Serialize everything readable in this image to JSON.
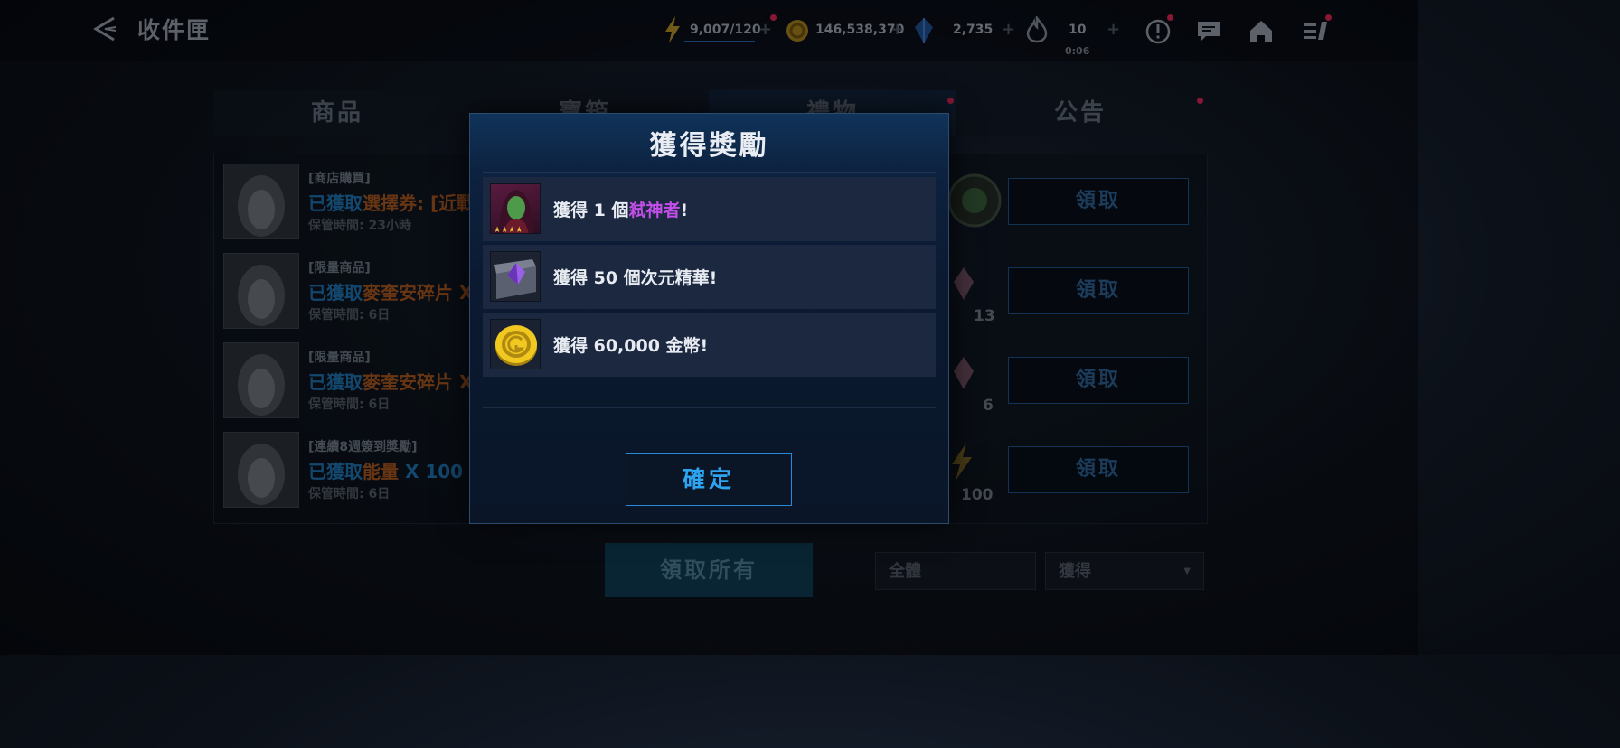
{
  "header": {
    "title": "收件匣",
    "energy": "9,007/120",
    "gold": "146,538,370",
    "crystals": "2,735",
    "tickets": "10",
    "tickets_timer": "0:06"
  },
  "tabs": [
    {
      "label": "商品"
    },
    {
      "label": "寶箱"
    },
    {
      "label": "禮物"
    },
    {
      "label": "公告"
    }
  ],
  "rows": [
    {
      "category": "[商店購買]",
      "prefix": "已獲取",
      "item": "選擇券: [近戰",
      "time": "保管時間: 23小時",
      "claim": "領取",
      "count": ""
    },
    {
      "category": "[限量商品]",
      "prefix": "已獲取",
      "item": "麥奎安碎片 X",
      "time": "保管時間: 6日",
      "claim": "領取",
      "count": "13"
    },
    {
      "category": "[限量商品]",
      "prefix": "已獲取",
      "item": "麥奎安碎片 X",
      "time": "保管時間: 6日",
      "claim": "領取",
      "count": "6"
    },
    {
      "category": "[連續8週簽到獎勵]",
      "prefix": "已獲取",
      "item": "能量",
      "suffix": " X 100 。",
      "time": "保管時間: 6日",
      "claim": "領取",
      "count": "100"
    }
  ],
  "bottom": {
    "claim_all": "領取所有",
    "filter_type": "全體",
    "filter_status": "獲得"
  },
  "modal": {
    "title": "獲得獎勵",
    "rewards": [
      {
        "prefix": "獲得 1 個",
        "highlight": "弒神者",
        "suffix": "!"
      },
      {
        "text": "獲得 50 個次元精華!"
      },
      {
        "text": "獲得 60,000 金幣!"
      }
    ],
    "confirm": "確定"
  },
  "colors": {
    "accent_blue": "#2ea3f0",
    "highlight_purple": "#c24fe8",
    "notification_red": "#d0244d"
  }
}
